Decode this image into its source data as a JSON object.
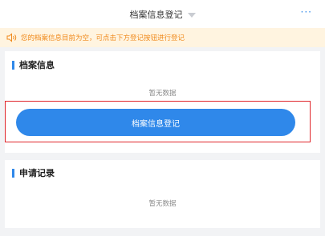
{
  "header": {
    "title": "档案信息登记",
    "more_label": "···"
  },
  "notice": {
    "icon": "speaker-icon",
    "text": "您的档案信息目前为空，可点击下方登记按钮进行登记"
  },
  "profile_section": {
    "title": "档案信息",
    "empty_text": "暂无数据",
    "register_button_label": "档案信息登记"
  },
  "records_section": {
    "title": "申请记录",
    "empty_text": "暂无数据"
  },
  "colors": {
    "accent": "#2f88ea",
    "notice_text": "#f08a1c",
    "notice_bg": "#fff4e0",
    "highlight_border": "#e0262b",
    "page_bg": "#f2f3f5"
  }
}
